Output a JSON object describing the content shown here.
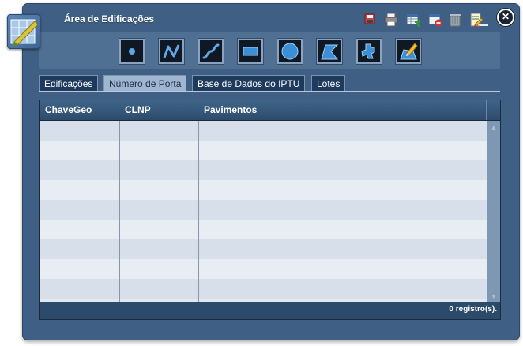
{
  "window": {
    "title": "Área de Edificações"
  },
  "header_toolbar": [
    {
      "name": "save-icon"
    },
    {
      "name": "print-icon"
    },
    {
      "name": "table-export-icon"
    },
    {
      "name": "delete-record-icon"
    },
    {
      "name": "trash-icon"
    },
    {
      "name": "edit-document-icon"
    }
  ],
  "draw_tools": [
    {
      "name": "point-tool-icon"
    },
    {
      "name": "polyline-tool-icon"
    },
    {
      "name": "curve-tool-icon"
    },
    {
      "name": "rectangle-tool-icon"
    },
    {
      "name": "circle-tool-icon"
    },
    {
      "name": "polygon-tool-icon"
    },
    {
      "name": "freehand-shape-tool-icon"
    },
    {
      "name": "edit-polygon-tool-icon"
    }
  ],
  "tabs": [
    {
      "label": "Edificações",
      "active": false
    },
    {
      "label": "Número de Porta",
      "active": true
    },
    {
      "label": "Base de Dados do IPTU",
      "active": false
    },
    {
      "label": "Lotes",
      "active": false
    }
  ],
  "grid": {
    "columns": [
      "ChaveGeo",
      "CLNP",
      "Pavimentos"
    ],
    "rows": []
  },
  "footer": {
    "records": "0 registro(s)."
  },
  "colors": {
    "window_bg": "#3f6084",
    "header_bg": "#2d4c6c",
    "active_tab": "#9fb6d0",
    "row_alt": "#d7e0ea"
  }
}
